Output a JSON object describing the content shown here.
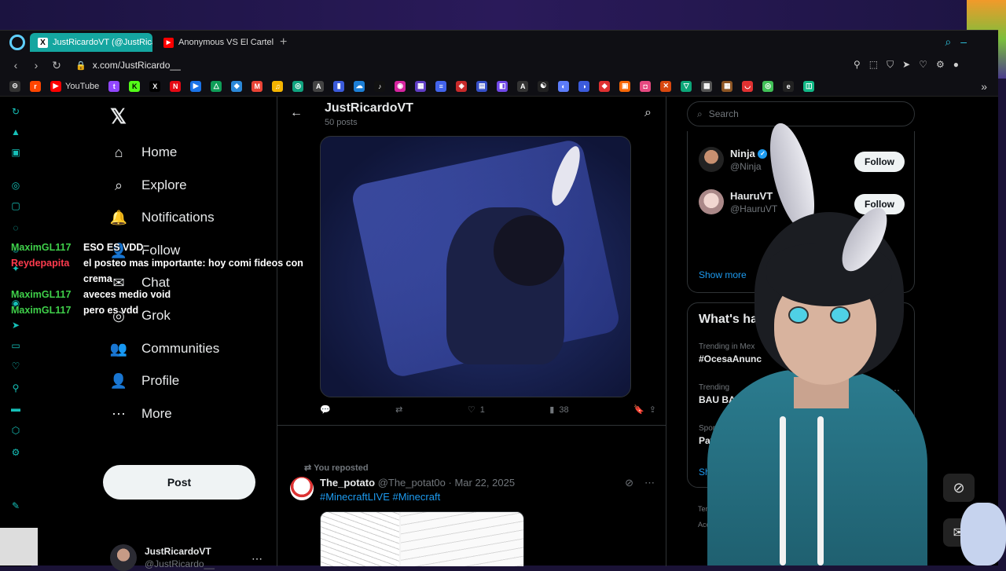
{
  "tabs": [
    {
      "title": "JustRicardoVT (@JustRica",
      "favicon": "X",
      "active": true
    },
    {
      "title": "Anonymous VS El Cartel M",
      "favicon": "YT",
      "active": false
    }
  ],
  "address": {
    "url": "x.com/JustRicardo__"
  },
  "bookmarks": {
    "youtube_label": "YouTube"
  },
  "x_nav": [
    {
      "label": "Home",
      "icon": "home-icon",
      "glyph": "⌂"
    },
    {
      "label": "Explore",
      "icon": "search-icon",
      "glyph": "⌕"
    },
    {
      "label": "Notifications",
      "icon": "bell-icon",
      "glyph": "🔔"
    },
    {
      "label": "Follow",
      "icon": "follow-icon",
      "glyph": "👤"
    },
    {
      "label": "Chat",
      "icon": "chat-icon",
      "glyph": "✉"
    },
    {
      "label": "Grok",
      "icon": "grok-icon",
      "glyph": "◎"
    },
    {
      "label": "Communities",
      "icon": "communities-icon",
      "glyph": "👥"
    },
    {
      "label": "Profile",
      "icon": "profile-icon",
      "glyph": "👤"
    },
    {
      "label": "More",
      "icon": "more-icon",
      "glyph": "⋯"
    }
  ],
  "post_button": "Post",
  "account": {
    "name": "JustRicardoVT",
    "handle": "@JustRicardo__"
  },
  "profile_header": {
    "name": "JustRicardoVT",
    "posts": "50 posts"
  },
  "tweet1": {
    "likes": "1",
    "views": "38"
  },
  "tweet2": {
    "repost_label": "You reposted",
    "author": "The_potato",
    "handle": "@The_potat0o",
    "date": "· Mar 22, 2025",
    "tags": "#MinecraftLIVE #Minecraft"
  },
  "search": {
    "placeholder": "Search"
  },
  "who_to_follow": [
    {
      "name": "Ninja",
      "handle": "@Ninja",
      "verified": true,
      "button": "Follow"
    },
    {
      "name": "HauruVT",
      "handle": "@HauruVT",
      "verified": false,
      "button": "Follow"
    }
  ],
  "show_more": "Show more",
  "trends": {
    "title": "What's ha",
    "items": [
      {
        "context": "Trending in Mex",
        "topic": "#OcesaAnunc"
      },
      {
        "context": "Trending",
        "topic": "BAU BAU"
      },
      {
        "context": "Sports · Trend",
        "topic": "Patriots"
      }
    ],
    "show": "Show"
  },
  "footer": {
    "line1": "Term",
    "line2": "Acce"
  },
  "chat": [
    {
      "user": "MaximGL117",
      "color": "#3fd04a",
      "msg": "ESO ES VDD"
    },
    {
      "user": "Reydepapita",
      "color": "#ff3b4e",
      "msg": "el posteo mas importante: hoy comi fideos con crema"
    },
    {
      "user": "MaximGL117",
      "color": "#3fd04a",
      "msg": "aveces medio void"
    },
    {
      "user": "MaximGL117",
      "color": "#3fd04a",
      "msg": "pero es vdd"
    }
  ],
  "colors": {
    "accent": "#1d9bf0",
    "tab_active": "#14a6a0",
    "sidebar_icons": "#16c0b8"
  }
}
